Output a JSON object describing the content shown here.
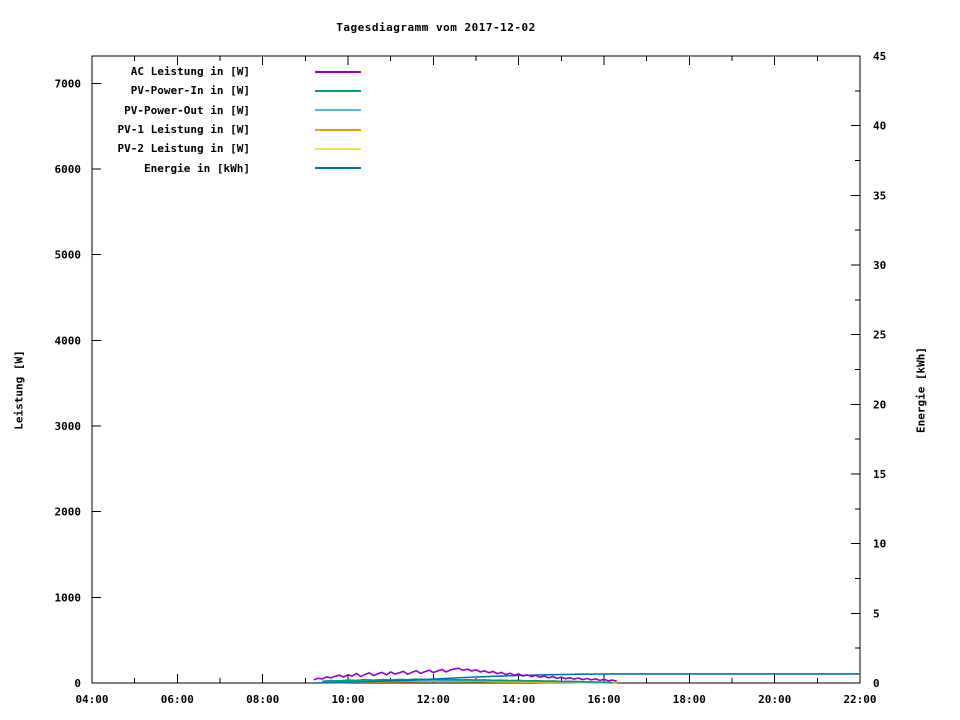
{
  "page": {
    "background": "#ffffff"
  },
  "chart_data": {
    "type": "line",
    "title": "Tagesdiagramm vom 2017-12-02",
    "ylabel": "Leistung [W]",
    "y2label": "Energie [kWh]",
    "legend_position": "top-left-inside",
    "x_axis": {
      "range_hours": [
        4,
        22
      ],
      "major_tick_hours": [
        4,
        6,
        8,
        10,
        12,
        14,
        16,
        18,
        20,
        22
      ],
      "major_tick_labels": [
        "04:00",
        "06:00",
        "08:00",
        "10:00",
        "12:00",
        "14:00",
        "16:00",
        "18:00",
        "20:00",
        "22:00"
      ],
      "minor_tick_hours": [
        5,
        7,
        9,
        11,
        13,
        15,
        17,
        19,
        21
      ]
    },
    "y_axis": {
      "label": "Leistung [W]",
      "range": [
        0,
        7320
      ],
      "ticks": [
        0,
        1000,
        2000,
        3000,
        4000,
        5000,
        6000,
        7000
      ]
    },
    "y2_axis": {
      "label": "Energie [kWh]",
      "range": [
        0,
        45
      ],
      "major_ticks": [
        0,
        5,
        10,
        15,
        20,
        25,
        30,
        35,
        40,
        45
      ],
      "minor_ticks": [
        2.5,
        7.5,
        12.5,
        17.5,
        22.5,
        27.5,
        32.5,
        37.5,
        42.5
      ]
    },
    "draw_order": [
      4,
      3,
      2,
      1,
      5,
      0
    ],
    "series": [
      {
        "name": "ac-leistung",
        "label": "AC Leistung in [W]",
        "color": "#9400d3",
        "axis": "y1",
        "x0": 9.2,
        "dx": 0.1,
        "values": [
          38,
          55,
          48,
          72,
          60,
          78,
          92,
          70,
          96,
          82,
          112,
          75,
          100,
          118,
          88,
          108,
          124,
          96,
          130,
          104,
          120,
          136,
          100,
          126,
          144,
          112,
          132,
          150,
          122,
          140,
          158,
          130,
          152,
          166,
          172,
          148,
          162,
          140,
          155,
          128,
          142,
          120,
          134,
          110,
          124,
          98,
          114,
          90,
          106,
          82,
          96,
          74,
          90,
          66,
          82,
          60,
          76,
          54,
          68,
          50,
          62,
          46,
          58,
          40,
          52,
          36,
          48,
          30,
          42,
          26,
          34,
          20
        ]
      },
      {
        "name": "pv-power-in",
        "label": "PV-Power-In in [W]",
        "color": "#009e73",
        "axis": "y1",
        "x0": 9.4,
        "dx": 0.2,
        "values": [
          20,
          28,
          25,
          34,
          30,
          38,
          33,
          40,
          36,
          42,
          38,
          44,
          40,
          43,
          38,
          41,
          36,
          39,
          34,
          36,
          31,
          33,
          28,
          30,
          25,
          27,
          22,
          24,
          19,
          20,
          16,
          14,
          11,
          8,
          5
        ]
      },
      {
        "name": "pv-power-out",
        "label": "PV-Power-Out in [W]",
        "color": "#56b4e9",
        "axis": "y1",
        "x0": 9.4,
        "dx": 0.2,
        "values": [
          14,
          21,
          19,
          27,
          23,
          30,
          26,
          32,
          29,
          34,
          30,
          36,
          32,
          35,
          30,
          33,
          29,
          31,
          27,
          29,
          24,
          26,
          22,
          24,
          19,
          21,
          17,
          18,
          14,
          15,
          12,
          10,
          8,
          6,
          4
        ]
      },
      {
        "name": "pv1-leistung",
        "label": "PV-1 Leistung in [W]",
        "color": "#e69f00",
        "axis": "y1",
        "x0": 9.5,
        "dx": 0.4,
        "values": [
          6,
          10,
          13,
          16,
          18,
          20,
          21,
          22,
          21,
          19,
          17,
          15,
          12,
          10,
          8,
          6,
          4,
          2
        ]
      },
      {
        "name": "pv2-leistung",
        "label": "PV-2 Leistung in [W]",
        "color": "#f0e442",
        "axis": "y1",
        "x0": 9.5,
        "dx": 0.4,
        "values": [
          4,
          7,
          10,
          12,
          14,
          16,
          17,
          17,
          16,
          15,
          13,
          11,
          9,
          7,
          6,
          4,
          3,
          1
        ]
      },
      {
        "name": "energie",
        "label": "Energie in [kWh]",
        "color": "#0072b2",
        "axis": "y2",
        "x": [
          9.2,
          9.6,
          10.0,
          10.5,
          11.0,
          11.5,
          12.0,
          12.5,
          13.0,
          13.5,
          14.0,
          14.5,
          15.0,
          15.5,
          16.0,
          16.3,
          22.0
        ],
        "values": [
          0,
          0.02,
          0.05,
          0.1,
          0.15,
          0.21,
          0.28,
          0.36,
          0.43,
          0.49,
          0.54,
          0.58,
          0.61,
          0.63,
          0.645,
          0.65,
          0.65
        ]
      }
    ]
  }
}
